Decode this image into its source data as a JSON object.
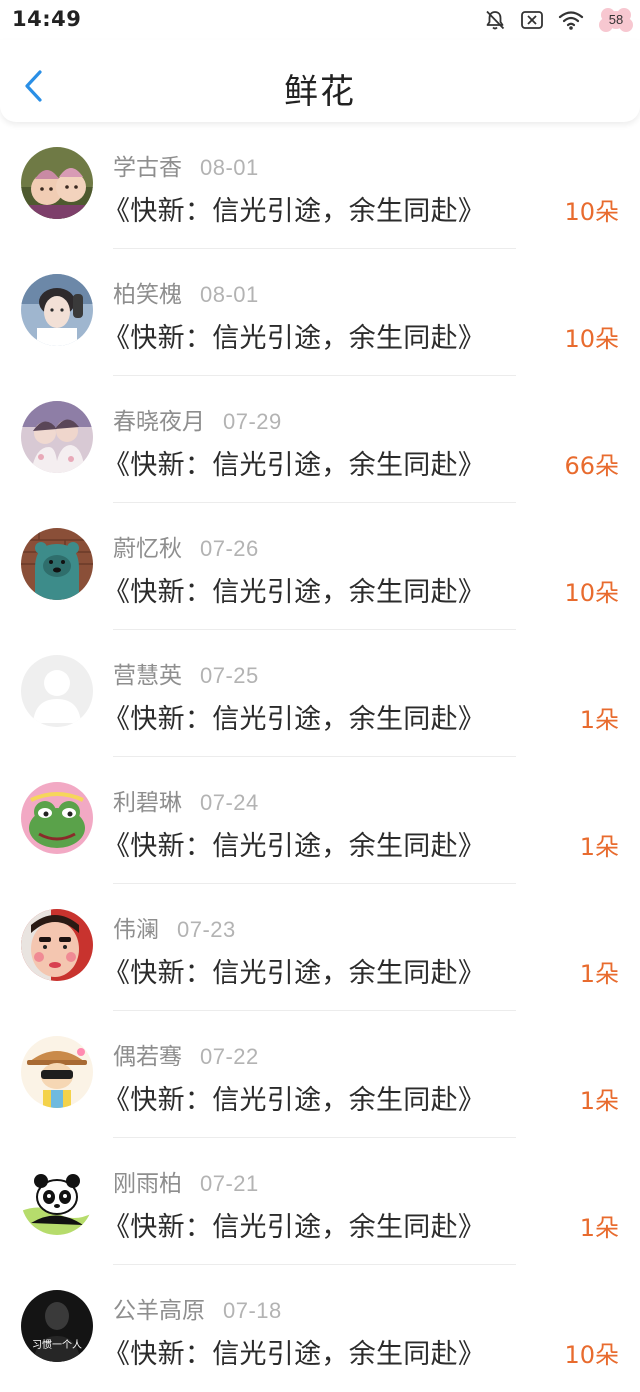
{
  "status_bar": {
    "time": "14:49",
    "battery": "58",
    "icons": [
      "bell-off-icon",
      "close-box-icon",
      "wifi-icon",
      "battery-flower-icon"
    ]
  },
  "header": {
    "title": "鲜花",
    "back_icon": "chevron-left-icon",
    "accent_color": "#2a8fe6"
  },
  "colors": {
    "flower_count": "#e86b2e",
    "date": "#b3b3b3",
    "user_name": "#8e8e8e"
  },
  "items": [
    {
      "user": "学古香",
      "date": "08-01",
      "title": "《快新：信光引途，余生同赴》",
      "flowers": "10朵"
    },
    {
      "user": "柏笑槐",
      "date": "08-01",
      "title": "《快新：信光引途，余生同赴》",
      "flowers": "10朵"
    },
    {
      "user": "春晓夜月",
      "date": "07-29",
      "title": "《快新：信光引途，余生同赴》",
      "flowers": "66朵"
    },
    {
      "user": "蔚忆秋",
      "date": "07-26",
      "title": "《快新：信光引途，余生同赴》",
      "flowers": "10朵"
    },
    {
      "user": "营慧英",
      "date": "07-25",
      "title": "《快新：信光引途，余生同赴》",
      "flowers": "1朵"
    },
    {
      "user": "利碧琳",
      "date": "07-24",
      "title": "《快新：信光引途，余生同赴》",
      "flowers": "1朵"
    },
    {
      "user": "伟澜",
      "date": "07-23",
      "title": "《快新：信光引途，余生同赴》",
      "flowers": "1朵"
    },
    {
      "user": "偶若骞",
      "date": "07-22",
      "title": "《快新：信光引途，余生同赴》",
      "flowers": "1朵"
    },
    {
      "user": "刚雨柏",
      "date": "07-21",
      "title": "《快新：信光引途，余生同赴》",
      "flowers": "1朵"
    },
    {
      "user": "公羊高原",
      "date": "07-18",
      "title": "《快新：信光引途，余生同赴》",
      "flowers": "10朵",
      "avatar_text": "习惯一个人"
    }
  ]
}
